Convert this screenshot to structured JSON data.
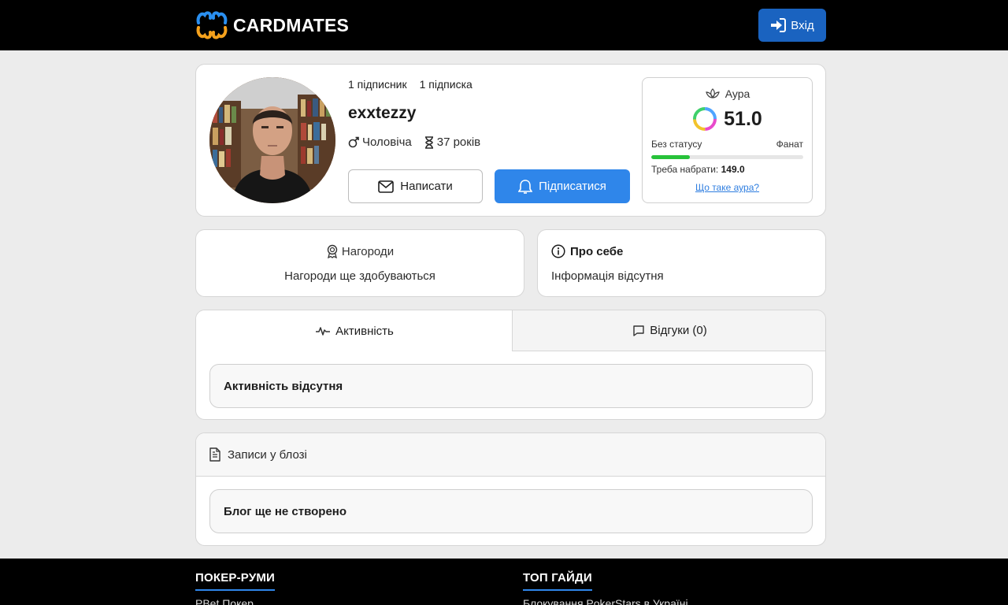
{
  "header": {
    "brand": "CARDMATES",
    "login_label": "Вхід"
  },
  "profile": {
    "followers": "1 підписник",
    "following": "1 підписка",
    "username": "exxtezzy",
    "gender": "Чоловіча",
    "age": "37 років",
    "write_label": "Написати",
    "subscribe_label": "Підписатися"
  },
  "aura": {
    "title": "Аура",
    "score": "51.0",
    "status_left": "Без статусу",
    "status_right": "Фанат",
    "progress": 0.255,
    "need_label": "Треба набрати:",
    "need_value": "149.0",
    "link": "Що таке аура?",
    "colors": {
      "progress": "#27c23a"
    }
  },
  "awards": {
    "title": "Нагороди",
    "text": "Нагороди ще здобуваються"
  },
  "about": {
    "title": "Про себе",
    "text": "Інформація відсутня"
  },
  "tabs": {
    "activity_label": "Активність",
    "reviews_label": "Відгуки (0)",
    "activity_empty": "Активність відсутня"
  },
  "blog": {
    "title": "Записи у блозі",
    "empty": "Блог ще не створено"
  },
  "footer": {
    "col1_title": "ПОКЕР-РУМИ",
    "col1_link": "PBet Покер",
    "col2_title": "ТОП ГАЙДИ",
    "col2_link": "Блокування PokerStars в Україні"
  },
  "colors": {
    "primary": "#2f86ea",
    "login": "#1a63c0",
    "logo_blue": "#2a8ff0",
    "logo_orange": "#f5a11c"
  }
}
